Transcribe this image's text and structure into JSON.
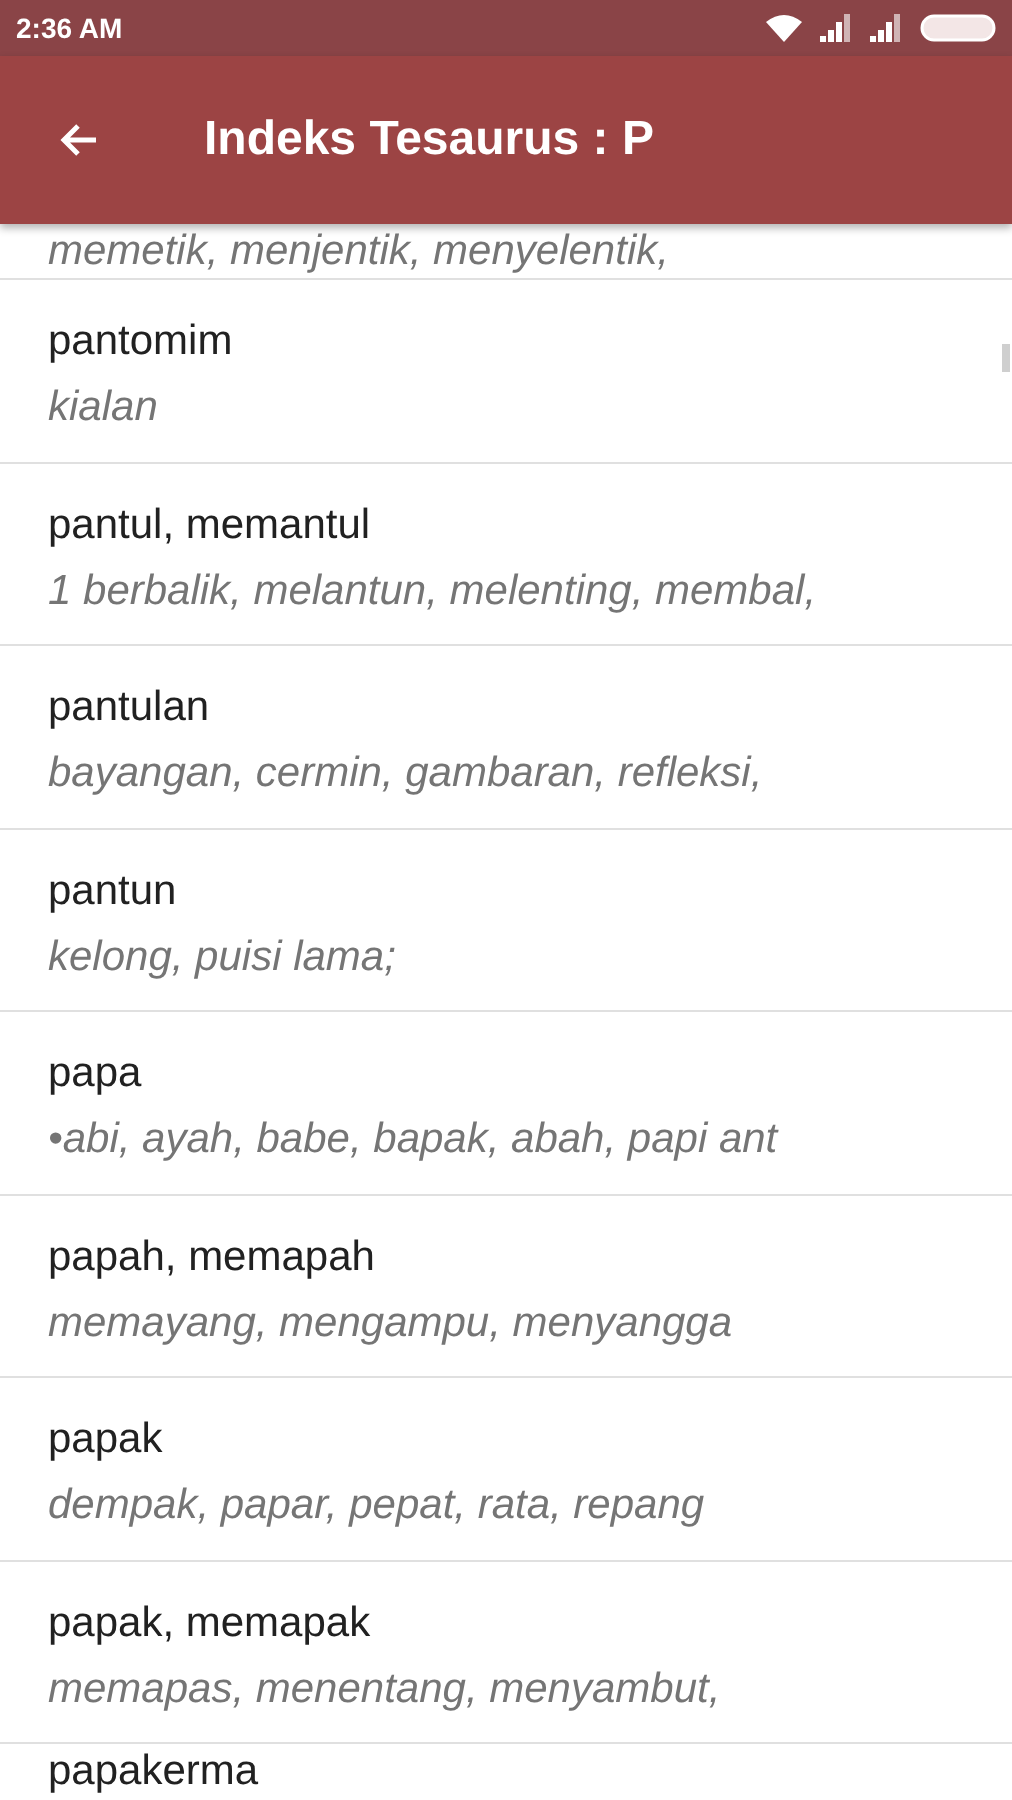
{
  "status_bar": {
    "time": "2:36 AM"
  },
  "app_bar": {
    "title": "Indeks Tesaurus : P"
  },
  "entries": [
    {
      "kind": "tail",
      "synonyms": "memetik, menjentik, menyelentik,"
    },
    {
      "kind": "entry",
      "headword": "pantomim",
      "synonyms": "kialan"
    },
    {
      "kind": "entry",
      "headword": "pantul, memantul",
      "synonyms": "1 berbalik, melantun, melenting, membal,"
    },
    {
      "kind": "entry",
      "headword": "pantulan",
      "synonyms": "bayangan, cermin, gambaran, refleksi,"
    },
    {
      "kind": "entry",
      "headword": "pantun",
      "synonyms": "kelong, puisi lama;"
    },
    {
      "kind": "entry",
      "headword": "papa",
      "synonyms": "•abi, ayah, babe, bapak, abah, papi ant"
    },
    {
      "kind": "entry",
      "headword": "papah, memapah",
      "synonyms": "memayang, mengampu, menyangga"
    },
    {
      "kind": "entry",
      "headword": "papak",
      "synonyms": "dempak, papar, pepat, rata, repang"
    },
    {
      "kind": "entry",
      "headword": "papak, memapak",
      "synonyms": "memapas, menentang, menyambut,"
    },
    {
      "kind": "head",
      "headword": "papakerma"
    }
  ]
}
